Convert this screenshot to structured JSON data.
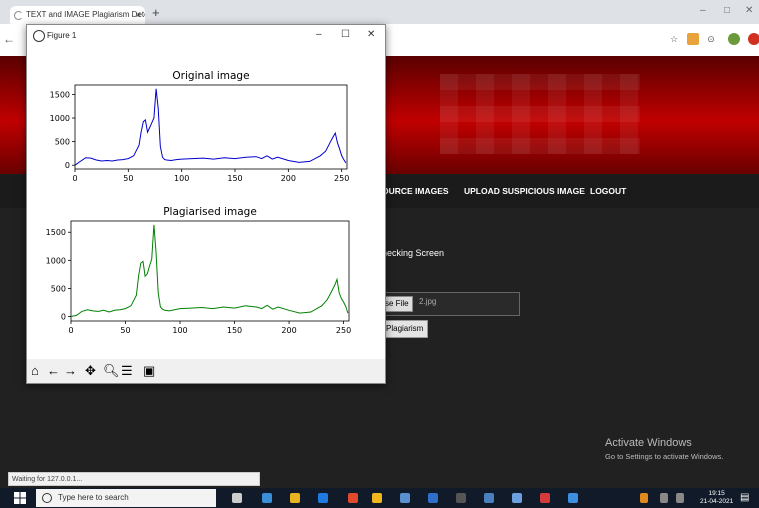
{
  "browser": {
    "tab_title": "TEXT and IMAGE Plagiarism Dete",
    "tab_close": "×",
    "new_tab": "+",
    "min": "–",
    "max": "□",
    "close": "✕"
  },
  "figure_window": {
    "title": "Figure 1",
    "min": "–",
    "max": "☐",
    "close": "✕",
    "toolbar": [
      "home",
      "back",
      "forward",
      "pan",
      "zoom",
      "configure",
      "save"
    ]
  },
  "nav": {
    "items": [
      "OURCE IMAGES",
      "UPLOAD SUSPICIOUS IMAGE",
      "LOGOUT"
    ]
  },
  "main": {
    "screen_title": "hecking Screen",
    "choose_file": "se File",
    "file_name": "2.jpg",
    "check_button": "Plagiarism"
  },
  "activate": {
    "title": "Activate Windows",
    "subtitle": "Go to Settings to activate Windows."
  },
  "status_text": "Waiting for 127.0.0.1...",
  "taskbar": {
    "search_placeholder": "Type here to search",
    "time": "19:15",
    "date": "21-04-2021"
  },
  "colors": {
    "series1": "#0000cc",
    "series2": "#008000",
    "banner": "#b00000"
  },
  "chart_data": [
    {
      "type": "line",
      "title": "Original image",
      "xlim": [
        0,
        255
      ],
      "ylim": [
        -80,
        1700
      ],
      "xticks": [
        0,
        50,
        100,
        150,
        200,
        250
      ],
      "yticks": [
        0,
        500,
        1000,
        1500
      ],
      "x": [
        0,
        5,
        10,
        15,
        20,
        25,
        30,
        35,
        40,
        45,
        50,
        55,
        60,
        62,
        64,
        66,
        68,
        70,
        72,
        74,
        76,
        78,
        80,
        82,
        84,
        86,
        90,
        95,
        100,
        110,
        120,
        130,
        140,
        150,
        160,
        170,
        175,
        180,
        185,
        190,
        200,
        210,
        220,
        230,
        235,
        240,
        242,
        244,
        246,
        248,
        250,
        252,
        254
      ],
      "values": [
        0,
        80,
        160,
        150,
        110,
        90,
        100,
        90,
        110,
        120,
        140,
        200,
        420,
        700,
        920,
        960,
        700,
        800,
        900,
        1000,
        1620,
        1200,
        400,
        170,
        120,
        110,
        100,
        120,
        130,
        140,
        150,
        130,
        160,
        140,
        170,
        180,
        140,
        200,
        130,
        170,
        100,
        60,
        80,
        200,
        300,
        520,
        600,
        680,
        480,
        350,
        200,
        120,
        50
      ]
    },
    {
      "type": "line",
      "title": "Plagiarised image",
      "xlim": [
        0,
        255
      ],
      "ylim": [
        -80,
        1700
      ],
      "xticks": [
        0,
        50,
        100,
        150,
        200,
        250
      ],
      "yticks": [
        0,
        500,
        1000,
        1500
      ],
      "x": [
        0,
        5,
        10,
        15,
        20,
        25,
        30,
        35,
        40,
        45,
        50,
        55,
        60,
        62,
        64,
        66,
        68,
        70,
        72,
        74,
        76,
        78,
        80,
        82,
        84,
        86,
        90,
        95,
        100,
        110,
        120,
        130,
        140,
        150,
        160,
        170,
        175,
        180,
        185,
        190,
        200,
        210,
        220,
        230,
        235,
        240,
        242,
        244,
        246,
        248,
        250,
        252,
        254
      ],
      "values": [
        0,
        20,
        90,
        120,
        100,
        90,
        110,
        80,
        110,
        120,
        140,
        190,
        380,
        720,
        950,
        980,
        720,
        760,
        900,
        1020,
        1630,
        1150,
        420,
        170,
        130,
        110,
        100,
        120,
        140,
        150,
        160,
        140,
        170,
        150,
        190,
        170,
        140,
        200,
        130,
        170,
        110,
        60,
        80,
        190,
        300,
        480,
        560,
        660,
        420,
        320,
        260,
        180,
        60
      ]
    }
  ]
}
